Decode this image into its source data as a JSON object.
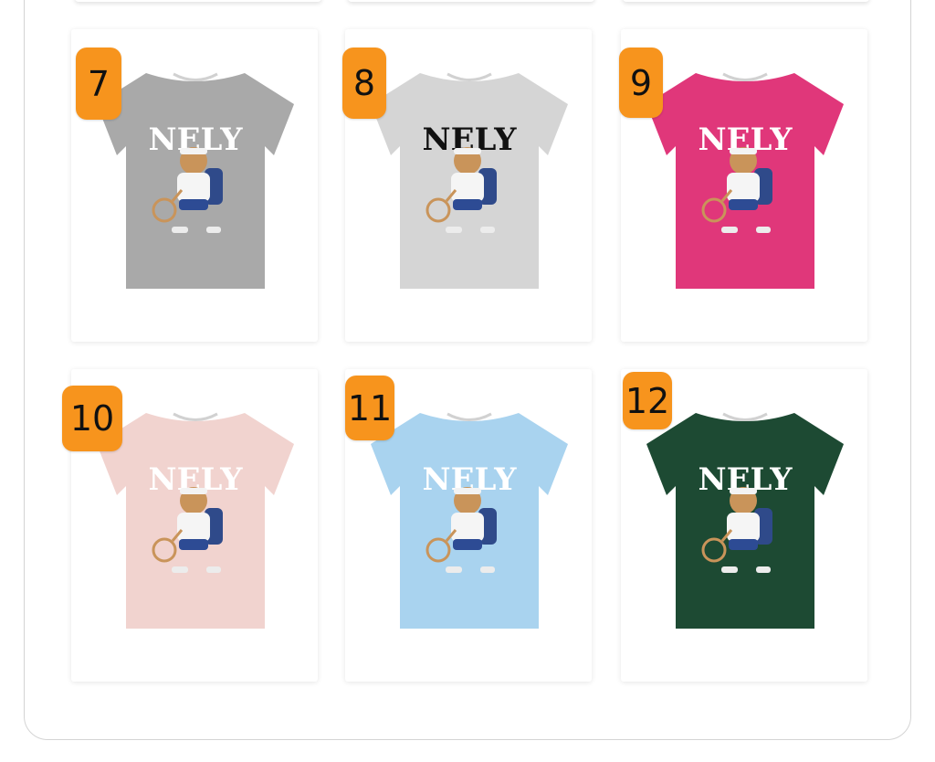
{
  "products": [
    {
      "number": "7",
      "brand": "NELY",
      "shirt_color": "#a9a9a9",
      "logo_color": "#ffffff"
    },
    {
      "number": "8",
      "brand": "NELY",
      "shirt_color": "#d5d5d5",
      "logo_color": "#111111"
    },
    {
      "number": "9",
      "brand": "NELY",
      "shirt_color": "#e0377a",
      "logo_color": "#ffffff"
    },
    {
      "number": "10",
      "brand": "NELY",
      "shirt_color": "#f1d3cf",
      "logo_color": "#ffffff"
    },
    {
      "number": "11",
      "brand": "NELY",
      "shirt_color": "#a9d3ef",
      "logo_color": "#ffffff"
    },
    {
      "number": "12",
      "brand": "NELY",
      "shirt_color": "#1d4a33",
      "logo_color": "#ffffff"
    }
  ],
  "colors": {
    "badge": "#f7941d",
    "border": "#d4d4d4"
  }
}
